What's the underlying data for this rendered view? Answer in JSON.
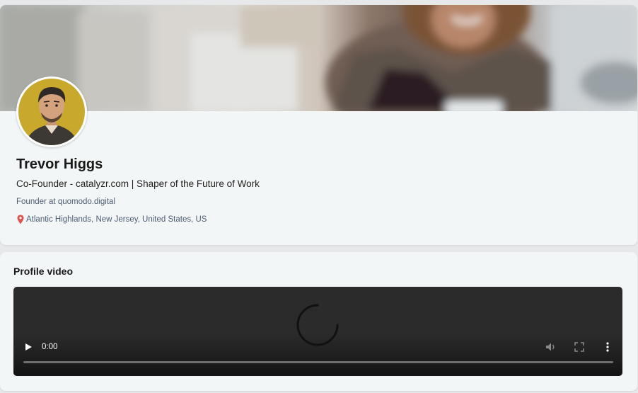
{
  "profile": {
    "name": "Trevor Higgs",
    "headline": "Co-Founder - catalyzr.com | Shaper of the Future of Work",
    "company": "Founder at quomodo.digital",
    "location": "Atlantic Highlands, New Jersey, United States, US"
  },
  "video": {
    "title": "Profile video",
    "time": "0:00",
    "progress": 0
  },
  "icons": {
    "location": "location-pin-icon",
    "play": "play-icon",
    "volume": "volume-icon",
    "fullscreen": "fullscreen-icon",
    "more": "more-vertical-icon",
    "loading": "loading-spinner-icon"
  },
  "colors": {
    "card_bg": "#f3f6f6",
    "page_bg": "#e6e8ea",
    "secondary_text": "#4c5d74",
    "pin": "#d9534f",
    "video_bg": "#2b2b2b"
  }
}
